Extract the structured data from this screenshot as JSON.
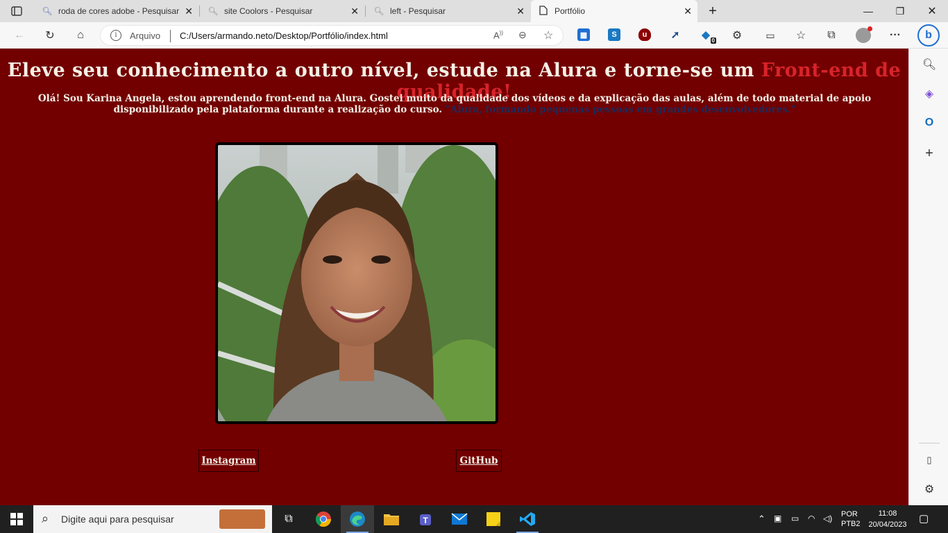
{
  "browser": {
    "tabs": [
      {
        "label": "roda de cores adobe - Pesquisar",
        "icon": "search-icon"
      },
      {
        "label": "site Coolors - Pesquisar",
        "icon": "search-icon"
      },
      {
        "label": "left - Pesquisar",
        "icon": "search-icon"
      },
      {
        "label": "Portfólio",
        "icon": "page-icon"
      }
    ],
    "address": {
      "security_label": "Arquivo",
      "url": "C:/Users/armando.neto/Desktop/Portfólio/index.html"
    },
    "extension_badge": "0"
  },
  "page": {
    "headline_main": "Eleve seu conhecimento a outro nível, estude na Alura e torne-se um ",
    "headline_highlight": "Front-end de qualidade!",
    "intro_text": "Olá! Sou Karina Angela, estou aprendendo front-end na Alura. Gostei muito da qualidade dos vídeos e da explicação das aulas, além de todo material de apoio disponibilizado pela plataforma durante a realização do curso. ",
    "intro_quote": "\"Alura, formando pequenas pessoas em grandes desenvolvedores.\"",
    "links": {
      "instagram": "Instagram",
      "github": "GitHub"
    }
  },
  "colors": {
    "page_background": "#720000",
    "highlight": "#d8232a",
    "text": "#f5f0e6",
    "quote": "#1e2a5a"
  },
  "taskbar": {
    "search_placeholder": "Digite aqui para pesquisar",
    "language": "POR",
    "keyboard": "PTB2",
    "time": "11:08",
    "date": "20/04/2023"
  }
}
